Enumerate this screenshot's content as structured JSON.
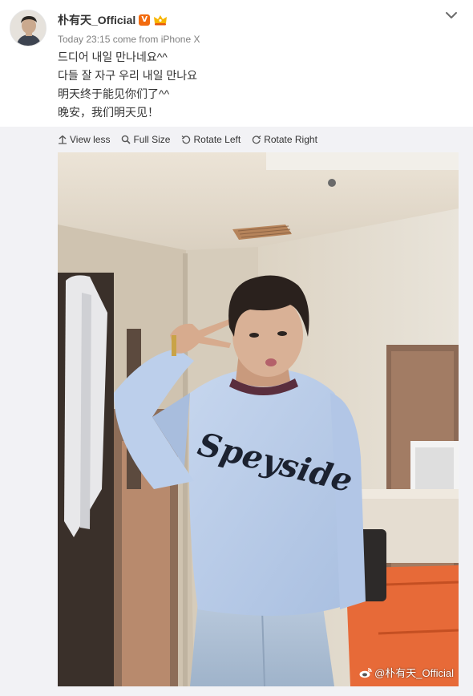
{
  "post": {
    "username": "朴有天_Official",
    "verified_badge": "V",
    "crown_icon": "crown-icon",
    "timestamp": "Today 23:15",
    "source": "come from iPhone X",
    "text_lines": [
      "드디어 내일 만나네요^^",
      "다들 잘 자구 우리 내일 만나요",
      "明天终于能见你们了^^",
      "晚安，我们明天见！"
    ]
  },
  "toolbar": {
    "view_less": "View less",
    "full_size": "Full Size",
    "rotate_left": "Rotate Left",
    "rotate_right": "Rotate Right"
  },
  "photo": {
    "shirt_text": "Speyside",
    "watermark": "@朴有天_Official"
  },
  "colors": {
    "verified": "#f26b0f",
    "expanded_bg": "#f2f2f5",
    "text": "#333333",
    "meta": "#808080"
  }
}
